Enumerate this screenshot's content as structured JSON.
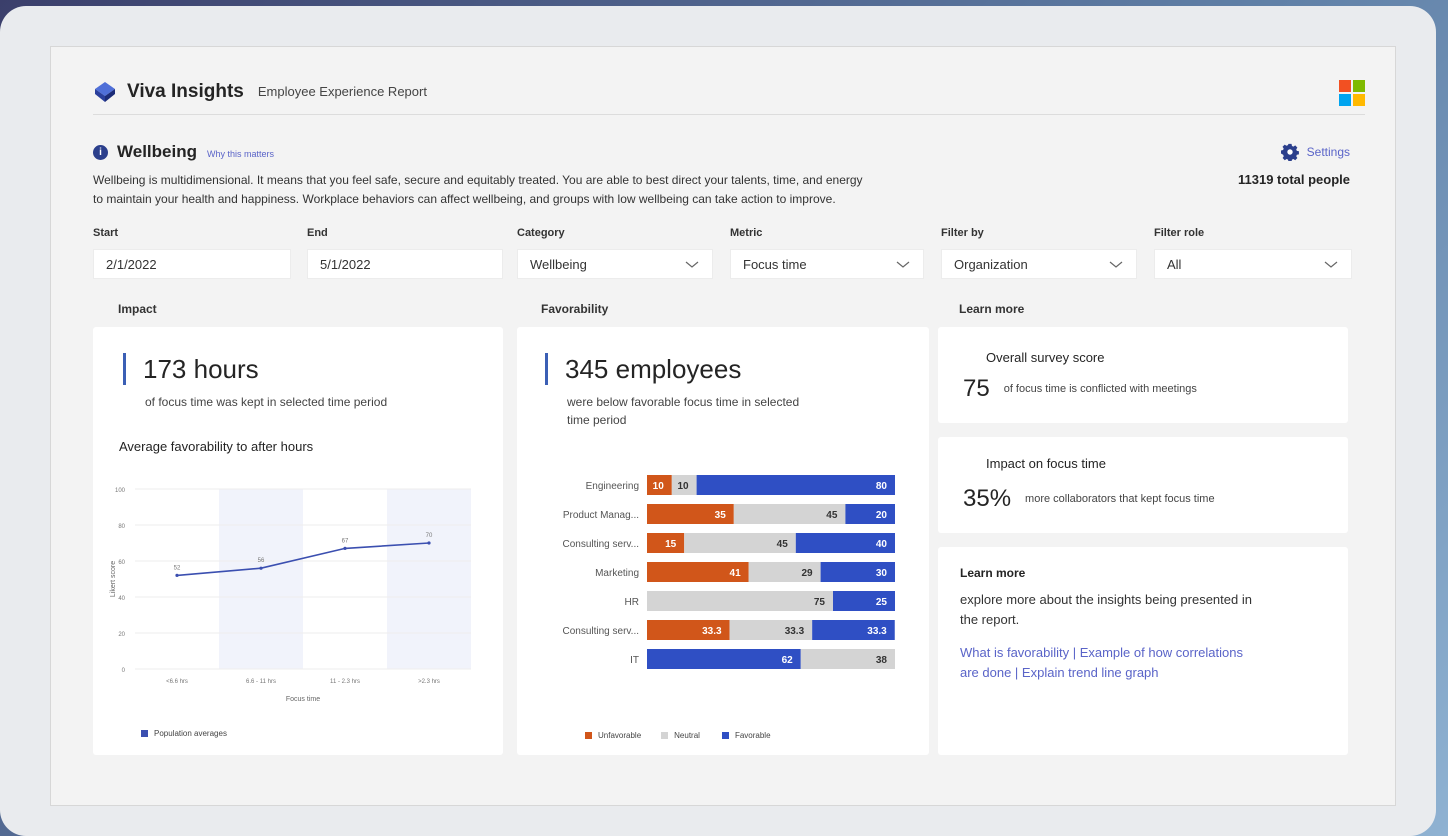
{
  "header": {
    "app_name": "Viva Insights",
    "report_name": "Employee Experience Report"
  },
  "section": {
    "title": "Wellbeing",
    "why_link": "Why this matters",
    "description_line1": "Wellbeing is multidimensional. It means that you feel safe, secure and equitably treated. You are able to best direct your talents, time, and energy",
    "description_line2": "to maintain your health and happiness. Workplace behaviors can affect wellbeing, and groups with low wellbeing can take action to improve.",
    "settings_label": "Settings",
    "total_people": "11319 total people"
  },
  "filters": {
    "start": {
      "label": "Start",
      "value": "2/1/2022"
    },
    "end": {
      "label": "End",
      "value": "5/1/2022"
    },
    "category": {
      "label": "Category",
      "value": "Wellbeing"
    },
    "metric": {
      "label": "Metric",
      "value": "Focus time"
    },
    "filter_by": {
      "label": "Filter by",
      "value": "Organization"
    },
    "filter_role": {
      "label": "Filter role",
      "value": "All"
    }
  },
  "columns": {
    "impact": "Impact",
    "favorability": "Favorability",
    "learn_more": "Learn more"
  },
  "impact": {
    "value": "173 hours",
    "sub": "of focus time was kept in selected time period",
    "chart_title": "Average favorability to after hours"
  },
  "favorability": {
    "value": "345 employees",
    "sub_line1": "were below favorable focus time in selected",
    "sub_line2": "time period"
  },
  "learn": {
    "survey_title": "Overall survey score",
    "survey_number": "75",
    "survey_text": "of focus time is conflicted with meetings",
    "impact_title": "Impact on focus time",
    "impact_number": "35%",
    "impact_text": "more collaborators that kept focus time",
    "more_head": "Learn more",
    "more_body_line1": "explore more about the insights being presented in",
    "more_body_line2": "the report.",
    "links_line1": "What is favorability  |  Example of how correlations",
    "links_line2": "are done | Explain trend line graph"
  },
  "colors": {
    "accent": "#3b5fb5",
    "unfavorable": "#d1561a",
    "neutral": "#d4d4d4",
    "favorable": "#2f4fc4",
    "link": "#5a64c8"
  },
  "chart_data": [
    {
      "type": "line",
      "title": "Average favorability to after hours",
      "xlabel": "Focus time",
      "ylabel": "Likert score",
      "categories": [
        "<6.6 hrs",
        "6.6 - 11 hrs",
        "11 - 2.3 hrs",
        ">2.3 hrs"
      ],
      "series": [
        {
          "name": "Population averages",
          "values": [
            52,
            56,
            67,
            70
          ]
        }
      ],
      "ylim": [
        0,
        100
      ],
      "yticks": [
        0,
        20,
        40,
        60,
        80,
        100
      ],
      "data_labels": [
        "52",
        "56",
        "67",
        "70"
      ],
      "legend": "bottom-left",
      "color": "#3b4fb0"
    },
    {
      "type": "bar",
      "orientation": "horizontal",
      "stacked": true,
      "categories": [
        "Engineering",
        "Product Manag...",
        "Consulting serv...",
        "Marketing",
        "HR",
        "Consulting serv...",
        "IT"
      ],
      "series": [
        {
          "name": "Unfavorable",
          "values": [
            10,
            35,
            15,
            41,
            0,
            33.3,
            0
          ],
          "color": "#d1561a"
        },
        {
          "name": "Neutral",
          "values": [
            10,
            45,
            45,
            29,
            75,
            33.3,
            38
          ],
          "color": "#d4d4d4"
        },
        {
          "name": "Favorable",
          "values": [
            80,
            20,
            40,
            30,
            25,
            33.3,
            62
          ],
          "color": "#2f4fc4"
        }
      ],
      "order": [
        [
          "u",
          "n",
          "f"
        ],
        [
          "u",
          "n",
          "f"
        ],
        [
          "u",
          "n",
          "f"
        ],
        [
          "u",
          "n",
          "f"
        ],
        [
          "u",
          "n",
          "f"
        ],
        [
          "u",
          "n",
          "f"
        ],
        [
          "f",
          "n",
          "u"
        ]
      ],
      "labels": [
        [
          "10",
          "10",
          "80"
        ],
        [
          "35",
          "45",
          "20"
        ],
        [
          "15",
          "45",
          "40"
        ],
        [
          "41",
          "29",
          "30"
        ],
        [
          "",
          "75",
          "25"
        ],
        [
          "33.3",
          "33.3",
          "33.3"
        ],
        [
          "62",
          "38",
          ""
        ]
      ],
      "legend": "bottom"
    }
  ]
}
